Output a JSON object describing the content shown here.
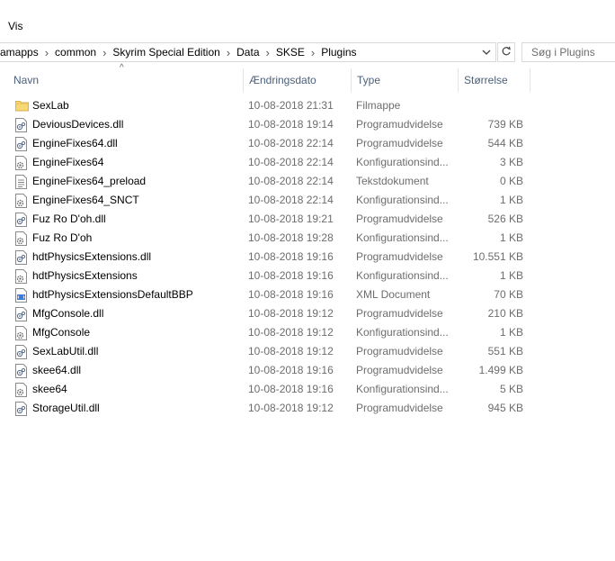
{
  "ribbon": {
    "tab_view": "Vis"
  },
  "address": {
    "crumbs": [
      "amapps",
      "common",
      "Skyrim Special Edition",
      "Data",
      "SKSE",
      "Plugins"
    ],
    "dropdown_icon": "chevron-down-icon",
    "refresh_icon": "refresh-icon"
  },
  "search": {
    "placeholder": "Søg i Plugins"
  },
  "columns": {
    "name": "Navn",
    "date": "Ændringsdato",
    "type": "Type",
    "size": "Størrelse"
  },
  "files": [
    {
      "name": "SexLab",
      "date": "10-08-2018 21:31",
      "type": "Filmappe",
      "size": "",
      "icon": "folder-icon"
    },
    {
      "name": "DeviousDevices.dll",
      "date": "10-08-2018 19:14",
      "type": "Programudvidelse",
      "size": "739 KB",
      "icon": "dll-file-icon"
    },
    {
      "name": "EngineFixes64.dll",
      "date": "10-08-2018 22:14",
      "type": "Programudvidelse",
      "size": "544 KB",
      "icon": "dll-file-icon"
    },
    {
      "name": "EngineFixes64",
      "date": "10-08-2018 22:14",
      "type": "Konfigurationsind...",
      "size": "3 KB",
      "icon": "config-file-icon"
    },
    {
      "name": "EngineFixes64_preload",
      "date": "10-08-2018 22:14",
      "type": "Tekstdokument",
      "size": "0 KB",
      "icon": "text-file-icon"
    },
    {
      "name": "EngineFixes64_SNCT",
      "date": "10-08-2018 22:14",
      "type": "Konfigurationsind...",
      "size": "1 KB",
      "icon": "config-file-icon"
    },
    {
      "name": "Fuz Ro D'oh.dll",
      "date": "10-08-2018 19:21",
      "type": "Programudvidelse",
      "size": "526 KB",
      "icon": "dll-file-icon"
    },
    {
      "name": "Fuz Ro D'oh",
      "date": "10-08-2018 19:28",
      "type": "Konfigurationsind...",
      "size": "1 KB",
      "icon": "config-file-icon"
    },
    {
      "name": "hdtPhysicsExtensions.dll",
      "date": "10-08-2018 19:16",
      "type": "Programudvidelse",
      "size": "10.551 KB",
      "icon": "dll-file-icon"
    },
    {
      "name": "hdtPhysicsExtensions",
      "date": "10-08-2018 19:16",
      "type": "Konfigurationsind...",
      "size": "1 KB",
      "icon": "config-file-icon"
    },
    {
      "name": "hdtPhysicsExtensionsDefaultBBP",
      "date": "10-08-2018 19:16",
      "type": "XML Document",
      "size": "70 KB",
      "icon": "xml-file-icon"
    },
    {
      "name": "MfgConsole.dll",
      "date": "10-08-2018 19:12",
      "type": "Programudvidelse",
      "size": "210 KB",
      "icon": "dll-file-icon"
    },
    {
      "name": "MfgConsole",
      "date": "10-08-2018 19:12",
      "type": "Konfigurationsind...",
      "size": "1 KB",
      "icon": "config-file-icon"
    },
    {
      "name": "SexLabUtil.dll",
      "date": "10-08-2018 19:12",
      "type": "Programudvidelse",
      "size": "551 KB",
      "icon": "dll-file-icon"
    },
    {
      "name": "skee64.dll",
      "date": "10-08-2018 19:16",
      "type": "Programudvidelse",
      "size": "1.499 KB",
      "icon": "dll-file-icon"
    },
    {
      "name": "skee64",
      "date": "10-08-2018 19:16",
      "type": "Konfigurationsind...",
      "size": "5 KB",
      "icon": "config-file-icon"
    },
    {
      "name": "StorageUtil.dll",
      "date": "10-08-2018 19:12",
      "type": "Programudvidelse",
      "size": "945 KB",
      "icon": "dll-file-icon"
    }
  ]
}
